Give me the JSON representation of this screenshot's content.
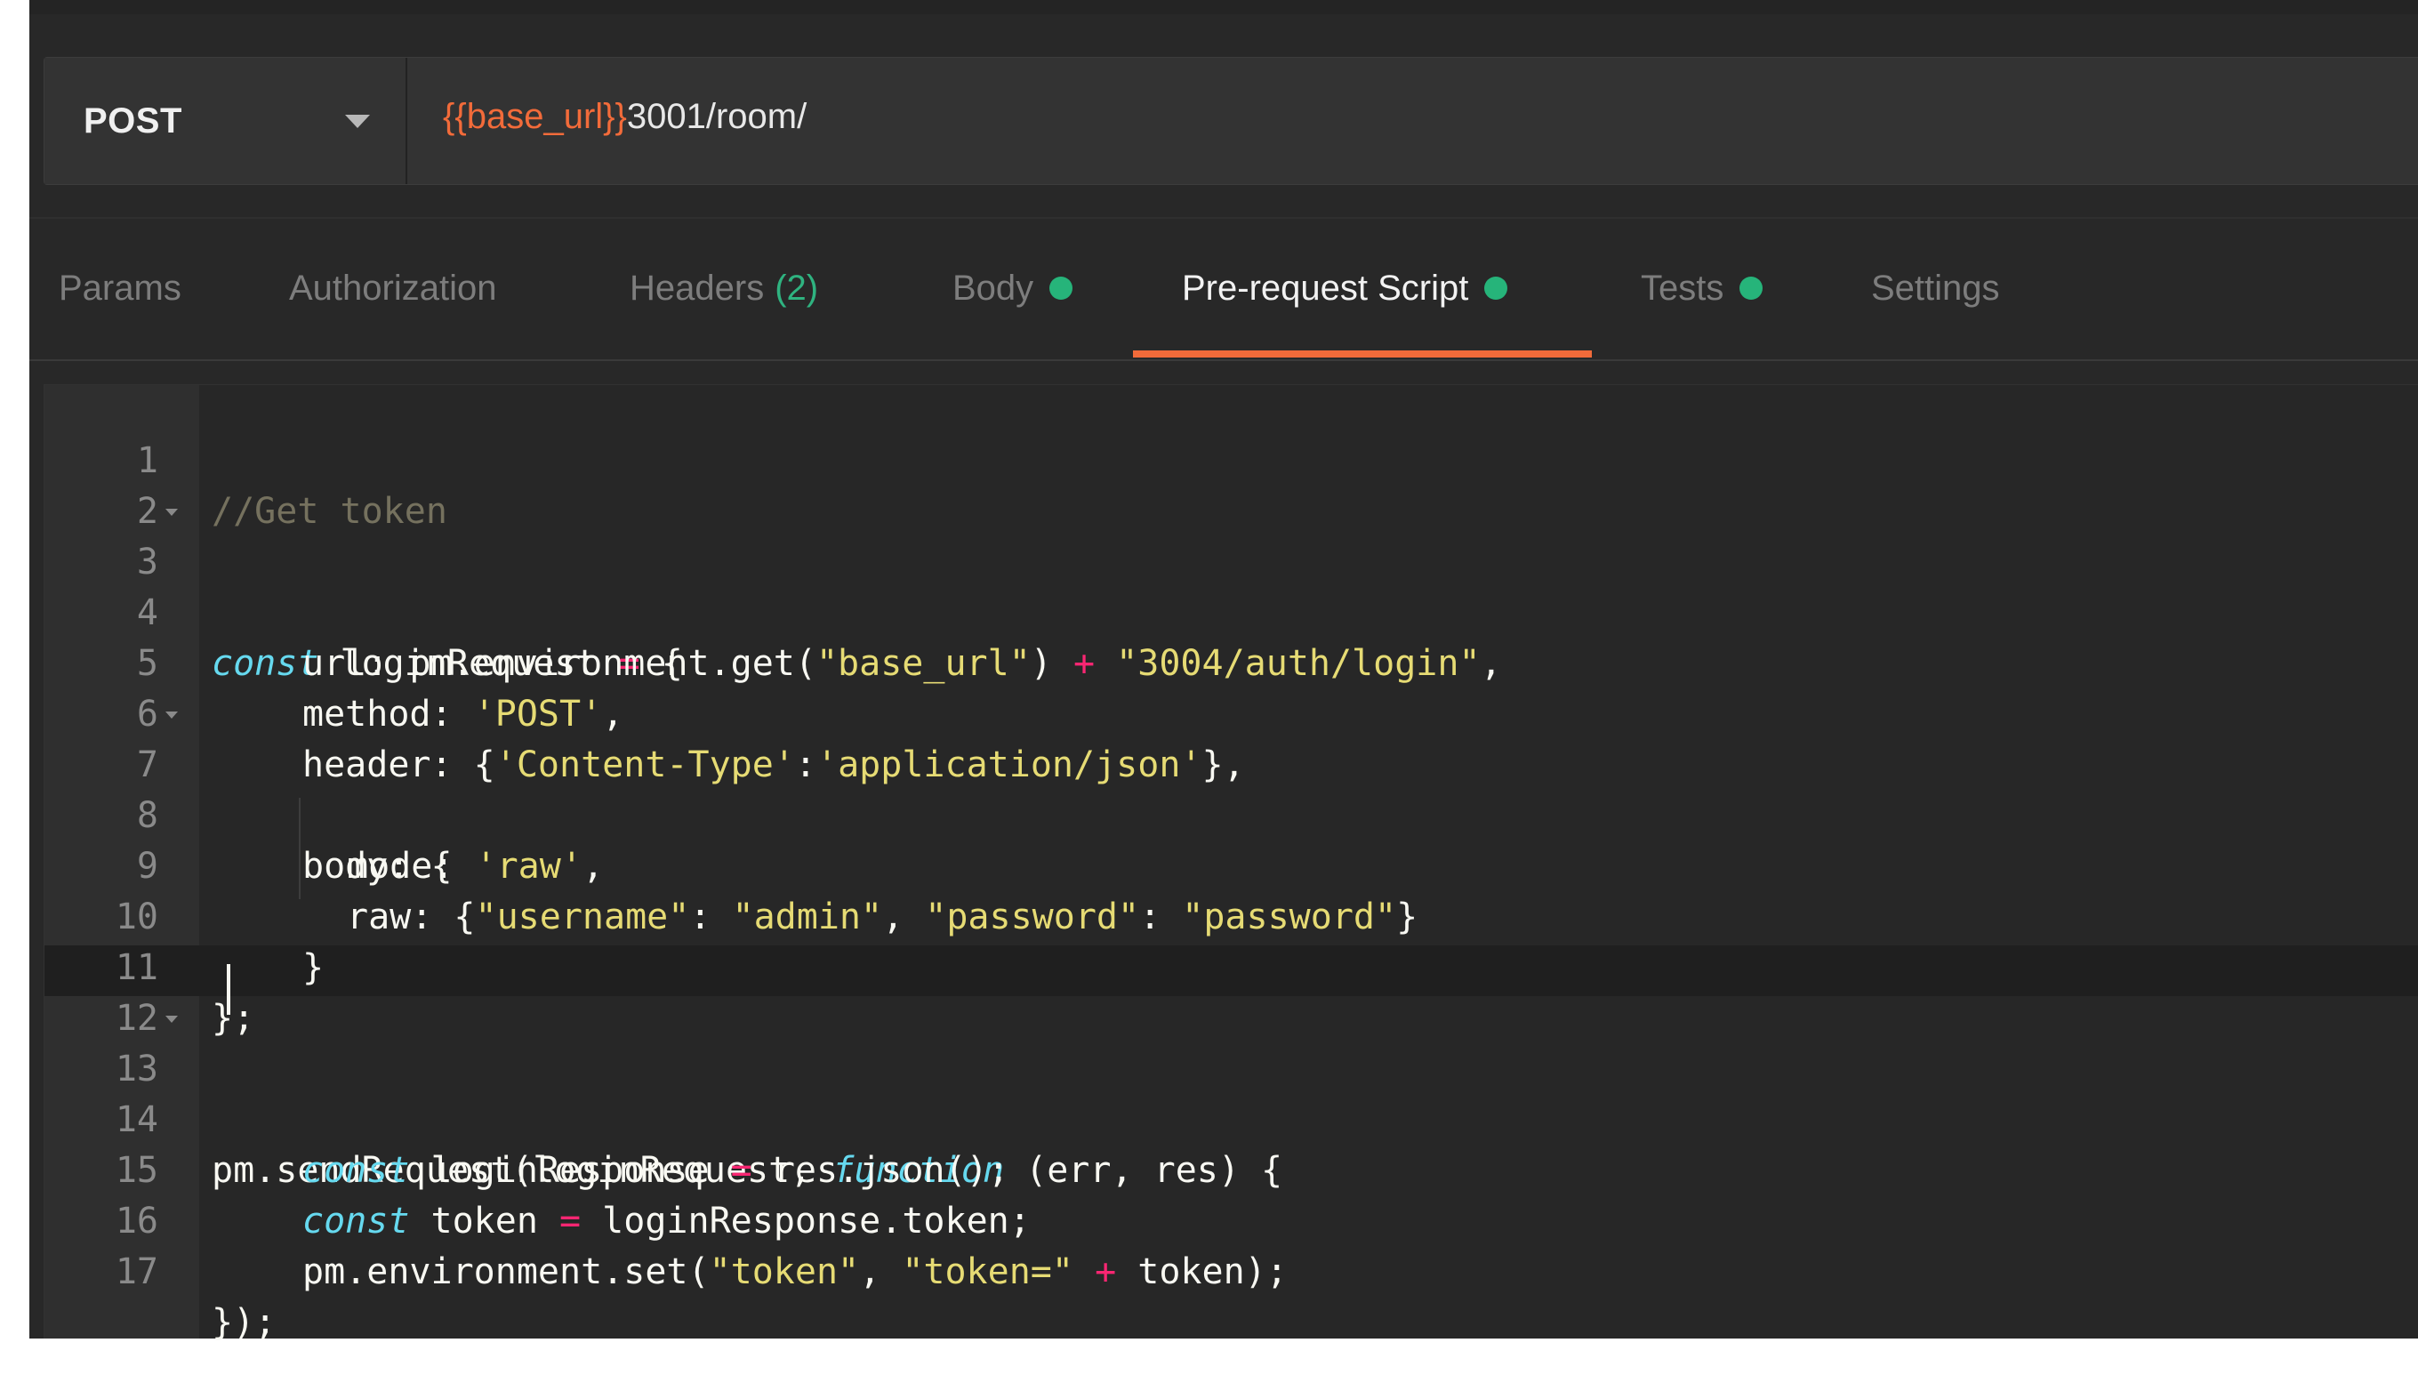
{
  "request": {
    "method": "POST",
    "url_variable": "{{base_url}}",
    "url_rest": "3001/room/"
  },
  "tabs": [
    {
      "label": "Params"
    },
    {
      "label": "Authorization"
    },
    {
      "label": "Headers",
      "count": "(2)"
    },
    {
      "label": "Body",
      "dot": true
    },
    {
      "label": "Pre-request Script",
      "dot": true,
      "active": true
    },
    {
      "label": "Tests",
      "dot": true
    },
    {
      "label": "Settings"
    }
  ],
  "colors": {
    "accent": "#f26b3a",
    "indicator_dot": "#26b47a",
    "count": "#2fb380"
  },
  "editor": {
    "active_line": 12,
    "lines": [
      {
        "n": "1"
      },
      {
        "n": "2"
      },
      {
        "n": "3"
      },
      {
        "n": "4"
      },
      {
        "n": "5"
      },
      {
        "n": "6"
      },
      {
        "n": "7"
      },
      {
        "n": "8"
      },
      {
        "n": "9"
      },
      {
        "n": "10"
      },
      {
        "n": "11"
      },
      {
        "n": "12"
      },
      {
        "n": "13"
      },
      {
        "n": "14"
      },
      {
        "n": "15"
      },
      {
        "n": "16"
      },
      {
        "n": "17"
      }
    ],
    "code": {
      "l1": "//Get token",
      "l3_kw": "const",
      "l3_a": " loginRequest ",
      "l3_op": "=",
      "l3_b": " {",
      "l4_a": "url: pm.environment.get(",
      "l4_s1": "\"base_url\"",
      "l4_b": ") ",
      "l4_op": "+",
      "l4_c": " ",
      "l4_s2": "\"3004/auth/login\"",
      "l4_d": ",",
      "l5_a": "method: ",
      "l5_s": "'POST'",
      "l5_b": ",",
      "l6_a": "header: {",
      "l6_s1": "'Content-Type'",
      "l6_b": ":",
      "l6_s2": "'application/json'",
      "l6_c": "},",
      "l7": "body: {",
      "l8_a": "mode: ",
      "l8_s": "'raw'",
      "l8_b": ",",
      "l9_a": "raw: {",
      "l9_s1": "\"username\"",
      "l9_b": ": ",
      "l9_s2": "\"admin\"",
      "l9_c": ", ",
      "l9_s3": "\"password\"",
      "l9_d": ": ",
      "l9_s4": "\"password\"",
      "l9_e": "}",
      "l10": "}",
      "l11": "};",
      "l13_a": "pm.sendRequest(loginRequest, ",
      "l13_kw": "function",
      "l13_b": " (err, res) {",
      "l14_kw": "const",
      "l14_a": " loginResponse ",
      "l14_op": "=",
      "l14_b": " res.json();",
      "l15_kw": "const",
      "l15_a": " token ",
      "l15_op": "=",
      "l15_b": " loginResponse.token;",
      "l16_a": "pm.environment.set(",
      "l16_s1": "\"token\"",
      "l16_b": ", ",
      "l16_s2": "\"token=\"",
      "l16_c": " ",
      "l16_op": "+",
      "l16_d": " token);",
      "l17": "});"
    }
  }
}
